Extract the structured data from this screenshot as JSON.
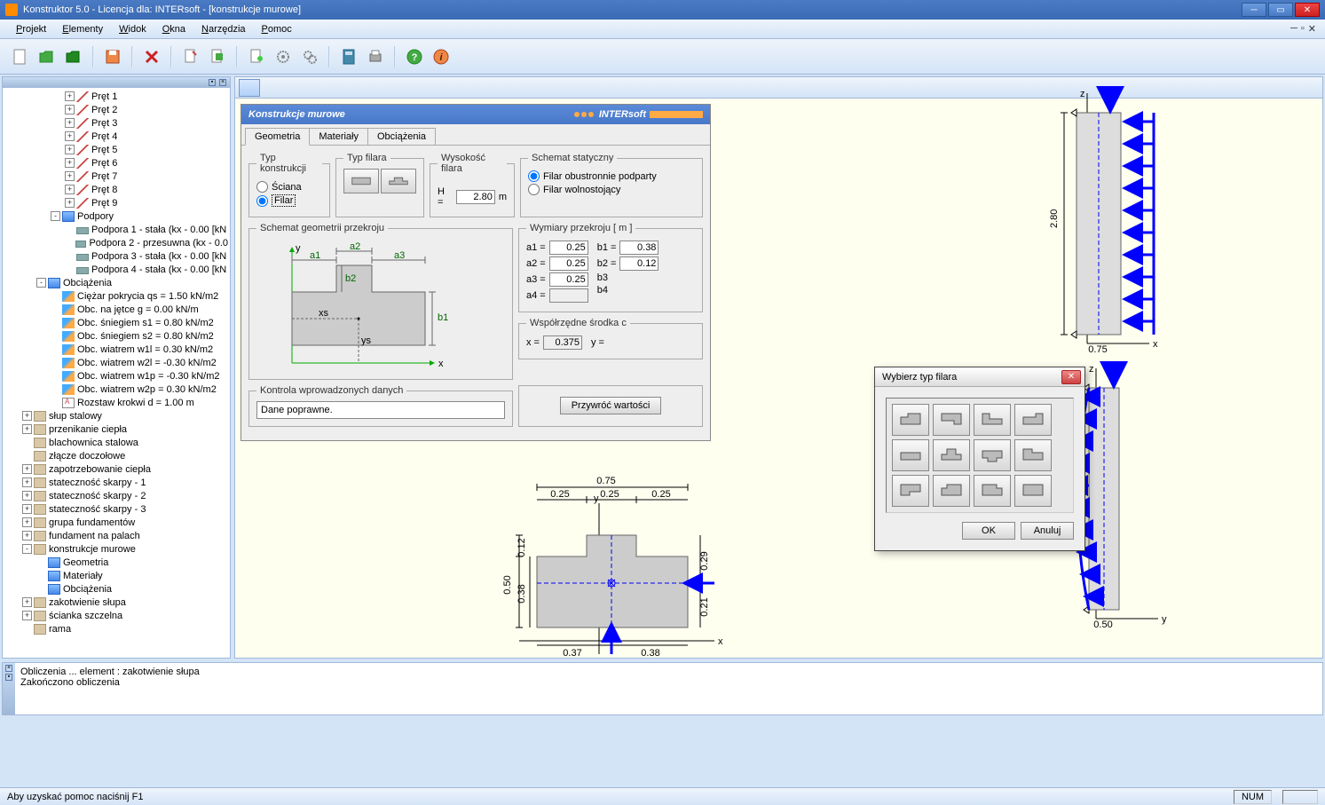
{
  "title": "Konstruktor 5.0 - Licencja dla: INTERsoft - [konstrukcje murowe]",
  "menubar": [
    "Projekt",
    "Elementy",
    "Widok",
    "Okna",
    "Narzędzia",
    "Pomoc"
  ],
  "panel": {
    "title": "Konstrukcje murowe",
    "brand": "INTERsoft",
    "tabs": [
      "Geometria",
      "Materiały",
      "Obciążenia"
    ],
    "typ_konstrukcji_legend": "Typ konstrukcji",
    "sciana": "Ściana",
    "filar": "Filar",
    "typ_filara_legend": "Typ filara",
    "wysokosc_legend": "Wysokość filara",
    "H_label": "H =",
    "H_value": "2.80",
    "H_unit": "m",
    "schemat_legend": "Schemat statyczny",
    "schemat_opt1": "Filar obustronnie podparty",
    "schemat_opt2": "Filar wolnostojący",
    "geom_legend": "Schemat geometrii przekroju",
    "wymiary_legend": "Wymiary przekroju [ m ]",
    "a1_label": "a1 =",
    "a1": "0.25",
    "b1_label": "b1 =",
    "b1": "0.38",
    "a2_label": "a2 =",
    "a2": "0.25",
    "b2_label": "b2 =",
    "b2": "0.12",
    "a3_label": "a3 =",
    "a3": "0.25",
    "b3_label": "b3",
    "a4_label": "a4 =",
    "a4": "",
    "b4_label": "b4",
    "wspol_legend": "Współrzędne środka c",
    "x_label": "x =",
    "x": "0.375",
    "y_label": "y =",
    "kontrola_legend": "Kontrola wprowadzonych danych",
    "kontrola_text": "Dane poprawne.",
    "przywroc": "Przywróć wartości"
  },
  "tree": {
    "prety": [
      "Pręt 1",
      "Pręt 2",
      "Pręt 3",
      "Pręt 4",
      "Pręt 5",
      "Pręt 6",
      "Pręt 7",
      "Pręt 8",
      "Pręt 9"
    ],
    "podpory_label": "Podpory",
    "podpory": [
      "Podpora 1 - stała (kx - 0.00 [kN",
      "Podpora 2 - przesuwna (kx - 0.0",
      "Podpora 3 - stała (kx - 0.00 [kN",
      "Podpora 4 - stała (kx - 0.00 [kN"
    ],
    "obciazenia_label": "Obciążenia",
    "obciazenia": [
      "Ciężar pokrycia qs = 1.50 kN/m2",
      "Obc. na jętce g = 0.00 kN/m",
      "Obc. śniegiem s1 = 0.80 kN/m2",
      "Obc. śniegiem s2 = 0.80 kN/m2",
      "Obc. wiatrem w1l = 0.30 kN/m2",
      "Obc. wiatrem w2l = -0.30 kN/m2",
      "Obc. wiatrem w1p = -0.30 kN/m2",
      "Obc. wiatrem w2p = 0.30 kN/m2",
      "Rozstaw krokwi d = 1.00 m"
    ],
    "modules": [
      "słup stalowy",
      "przenikanie ciepła",
      "blachownica stalowa",
      "złącze doczołowe",
      "zapotrzebowanie ciepła",
      "stateczność skarpy - 1",
      "stateczność skarpy - 2",
      "stateczność skarpy - 3",
      "grupa fundamentów",
      "fundament na palach",
      "konstrukcje murowe"
    ],
    "murowe_children": [
      "Geometria",
      "Materiały",
      "Obciążenia"
    ],
    "zakotwienie": "zakotwienie słupa",
    "scianka": "ścianka szczelna",
    "rama": "rama"
  },
  "modal": {
    "title": "Wybierz typ filara",
    "ok": "OK",
    "cancel": "Anuluj"
  },
  "bottom": {
    "line1": "Obliczenia ... element : zakotwienie słupa",
    "line2": "Zakończono obliczenia"
  },
  "status": {
    "left": "Aby uzyskać pomoc naciśnij F1",
    "num": "NUM"
  },
  "diagrams": {
    "sec_075": "0.75",
    "sec_050": "0.50",
    "sec_280": "2.80",
    "cs_075": "0.75",
    "cs_025a": "0.25",
    "cs_025b": "0.25",
    "cs_025c": "0.25",
    "cs_012": "0.12",
    "cs_038": "0.38",
    "cs_050": "0.50",
    "cs_029": "0.29",
    "cs_021": "0.21",
    "cs_037": "0.37",
    "cs_038b": "0.38",
    "ax_x": "x",
    "ax_y": "y",
    "ax_z": "z",
    "geom_a1": "a1",
    "geom_a2": "a2",
    "geom_a3": "a3",
    "geom_b1": "b1",
    "geom_b2": "b2",
    "geom_xs": "xs",
    "geom_ys": "ys"
  }
}
